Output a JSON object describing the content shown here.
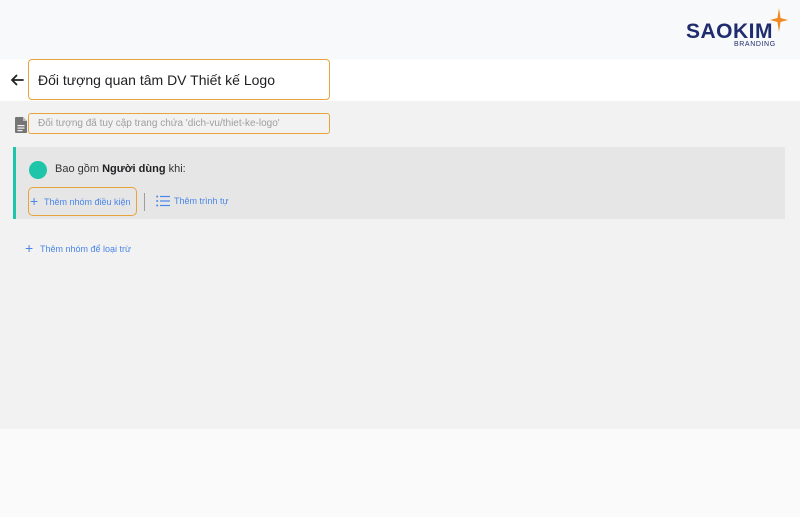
{
  "brand": {
    "name": "SAOKIM",
    "tagline": "BRANDING",
    "color": "#1f2d6e",
    "star_color": "#f08a24"
  },
  "header": {
    "back_icon": "arrow-left-icon",
    "title_value": "Đối tượng quan tâm DV Thiết kế Logo"
  },
  "description": {
    "icon": "document-icon",
    "value": "Đối tượng đã tuy cập trang chứa 'dich-vu/thiet-ke-logo'"
  },
  "include_group": {
    "label_prefix": "Bao gồm",
    "label_bold": "Người dùng",
    "label_suffix": "khi:",
    "accent": "#1fc5a8",
    "add_condition_group": "Thêm nhóm điều kiện",
    "add_sequence": "Thêm trình tự"
  },
  "exclude": {
    "add_exclude_group": "Thêm nhóm để loại trừ"
  },
  "colors": {
    "link": "#4a86e8",
    "focus_border": "#e8a33d"
  }
}
